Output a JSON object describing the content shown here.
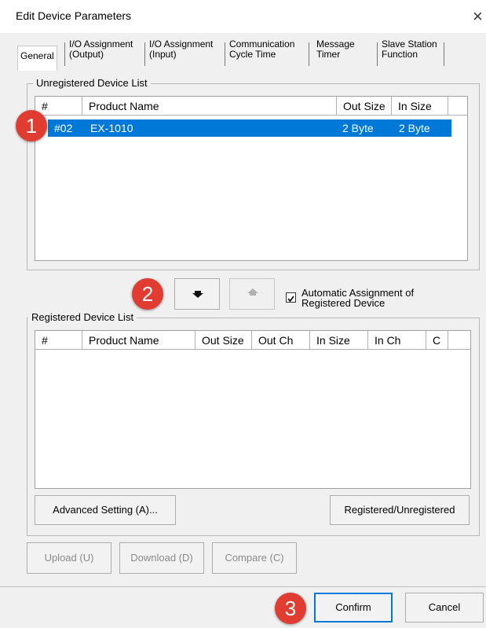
{
  "window": {
    "title": "Edit Device Parameters",
    "close_glyph": "×"
  },
  "tabs": [
    {
      "line1": "General",
      "line2": ""
    },
    {
      "line1": "I/O Assignment",
      "line2": "(Output)"
    },
    {
      "line1": "I/O Assignment",
      "line2": "(Input)"
    },
    {
      "line1": "Communication",
      "line2": "Cycle Time"
    },
    {
      "line1": "Message",
      "line2": "Timer"
    },
    {
      "line1": "Slave Station",
      "line2": "Function"
    }
  ],
  "unregistered": {
    "title": "Unregistered Device List",
    "columns": [
      "#",
      "Product Name",
      "Out Size",
      "In Size"
    ],
    "rows": [
      {
        "num": "#02",
        "name": "EX-1010",
        "out_size": "2 Byte",
        "in_size": "2 Byte",
        "selected": true
      }
    ]
  },
  "move": {
    "register_icon": "arrow-down-icon",
    "unregister_icon": "arrow-up-icon",
    "auto_assign_checked": true,
    "auto_assign_line1": "Automatic Assignment of",
    "auto_assign_line2": "Registered Device"
  },
  "registered": {
    "title": "Registered Device List",
    "columns": [
      "#",
      "Product Name",
      "Out Size",
      "Out Ch",
      "In Size",
      "In Ch",
      "C"
    ],
    "rows": []
  },
  "buttons": {
    "advanced": "Advanced Setting (A)...",
    "reg_unreg": "Registered/Unregistered",
    "upload": "Upload (U)",
    "download": "Download (D)",
    "compare": "Compare (C)",
    "confirm": "Confirm",
    "cancel": "Cancel"
  },
  "badges": [
    "1",
    "2",
    "3"
  ],
  "colors": {
    "selection": "#0078d7",
    "badge": "#e03c31"
  }
}
